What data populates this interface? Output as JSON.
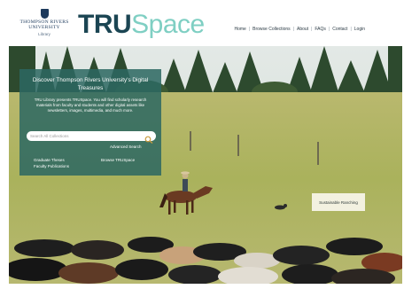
{
  "header": {
    "university_line1": "THOMPSON RIVERS",
    "university_line2": "UNIVERSITY",
    "university_sub": "Library",
    "brand_part1": "TRU",
    "brand_part2": "Space",
    "brand_colors": {
      "dark": "#1b4553",
      "light": "#7fcfc3"
    }
  },
  "nav": {
    "items": [
      "Home",
      "Browse Collections",
      "About",
      "FAQs",
      "Contact",
      "Login"
    ],
    "separator": "|"
  },
  "panel": {
    "title": "Discover Thompson Rivers University's Digital Treasures",
    "description": "TRU Library presents TRUSpace. You will find scholarly research materials from faculty and students and other digital assets like newsletters, images, multimedia, and much more.",
    "search_placeholder": "Search All Collections",
    "search_icon": "magnifier-icon",
    "advanced_search": "Advanced Search",
    "link_theses": "Graduate Theses",
    "link_browse": "Browse TRUSpace",
    "link_faculty": "Faculty Publications",
    "background": "#2c6862"
  },
  "hero": {
    "caption": "Sustainable Ranching"
  }
}
